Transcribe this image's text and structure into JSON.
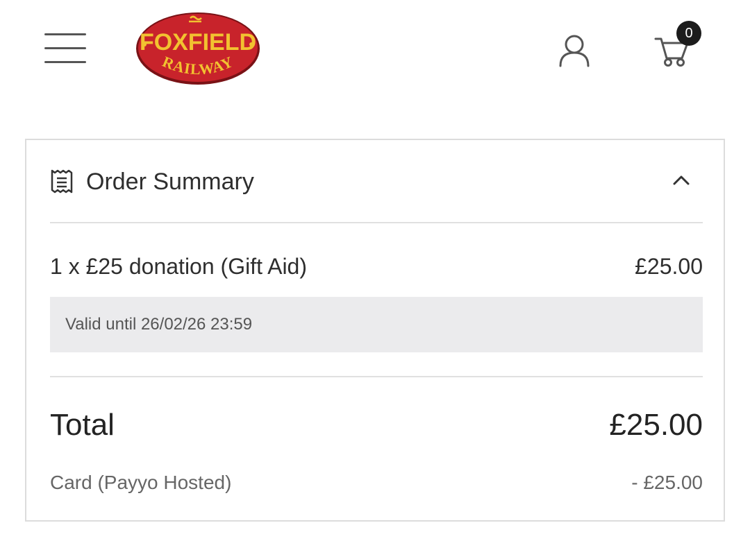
{
  "header": {
    "menu_icon": "hamburger-menu-icon",
    "logo": {
      "line1": "FOXFIELD",
      "line2": "RAILWAY",
      "colors": {
        "oval": "#c8232b",
        "text": "#f2c230"
      }
    },
    "account_icon": "user-icon",
    "cart_icon": "cart-icon",
    "cart_count": "0"
  },
  "order_summary": {
    "title": "Order Summary",
    "title_icon": "receipt-icon",
    "toggle_icon": "chevron-up-icon",
    "items": [
      {
        "description": "1 x £25 donation (Gift Aid)",
        "price": "£25.00",
        "validity": "Valid until 26/02/26 23:59"
      }
    ],
    "total_label": "Total",
    "total_amount": "£25.00",
    "payment": {
      "method": "Card (Payyo Hosted)",
      "amount": "- £25.00"
    }
  },
  "colors": {
    "text": "#2e2e2e",
    "muted": "#666666",
    "validity_bg": "#ebebed",
    "border": "#dcdcdc"
  }
}
